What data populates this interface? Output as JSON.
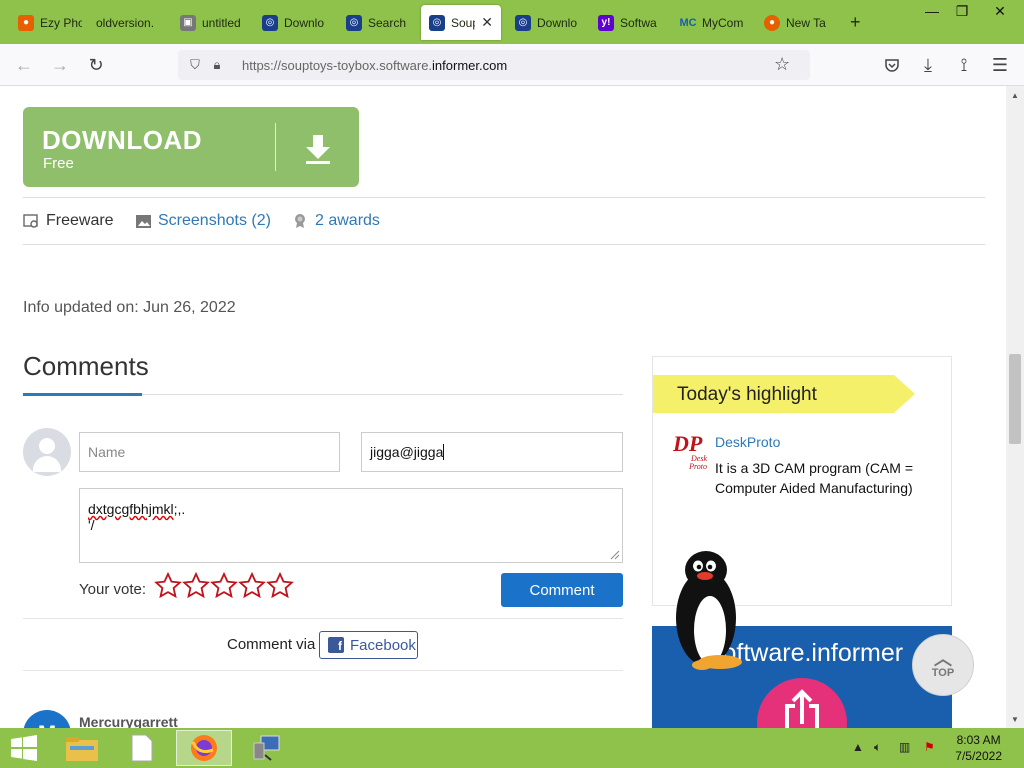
{
  "browser": {
    "tabs": [
      {
        "label": "Ezy Pho",
        "favicon": "firefox-icon"
      },
      {
        "label": "oldversion.",
        "favicon": "blank-icon"
      },
      {
        "label": "untitled",
        "favicon": "image-icon"
      },
      {
        "label": "Downlo",
        "favicon": "informer-icon"
      },
      {
        "label": "Search",
        "favicon": "informer-icon"
      },
      {
        "label": "Soup",
        "favicon": "informer-icon",
        "active": true
      },
      {
        "label": "Downlo",
        "favicon": "informer-icon"
      },
      {
        "label": "Softwa",
        "favicon": "yahoo-icon"
      },
      {
        "label": "MyCom",
        "favicon": "mc-icon"
      },
      {
        "label": "New Ta",
        "favicon": "firefox-icon"
      }
    ],
    "url_prefix": "https://souptoys-toybox.software.",
    "url_domain": "informer.com"
  },
  "download": {
    "title": "DOWNLOAD",
    "subtitle": "Free"
  },
  "meta": {
    "license": "Freeware",
    "screenshots": "Screenshots (2)",
    "awards": "2 awards"
  },
  "info_updated": "Info updated on: Jun 26, 2022",
  "comments": {
    "heading": "Comments",
    "name_placeholder": "Name",
    "email_value": "jigga@jigga",
    "text_line1": "dxtgcgfbhjmkl",
    "text_line1_tail": ";,.",
    "text_line2": "'/",
    "vote_label": "Your vote:",
    "stars": 5,
    "submit": "Comment",
    "via_label": "Comment via",
    "facebook": "Facebook",
    "next_author": "Mercurygarrett",
    "next_initial": "M"
  },
  "highlight": {
    "title": "Today's highlight",
    "logo_big": "DP",
    "logo_small1": "Desk",
    "logo_small2": "Proto",
    "name": "DeskProto",
    "description": "It is a 3D CAM program (CAM = Computer Aided Manufacturing)"
  },
  "ad": {
    "text": "software.informer"
  },
  "top_button": "TOP",
  "taskbar": {
    "time": "8:03 AM",
    "date": "7/5/2022"
  },
  "colors": {
    "accent_green": "#8fc24a",
    "download_green": "#8fbf6a",
    "link_blue": "#2f79b7",
    "button_blue": "#1a73c9",
    "star_red": "#c0121a"
  }
}
